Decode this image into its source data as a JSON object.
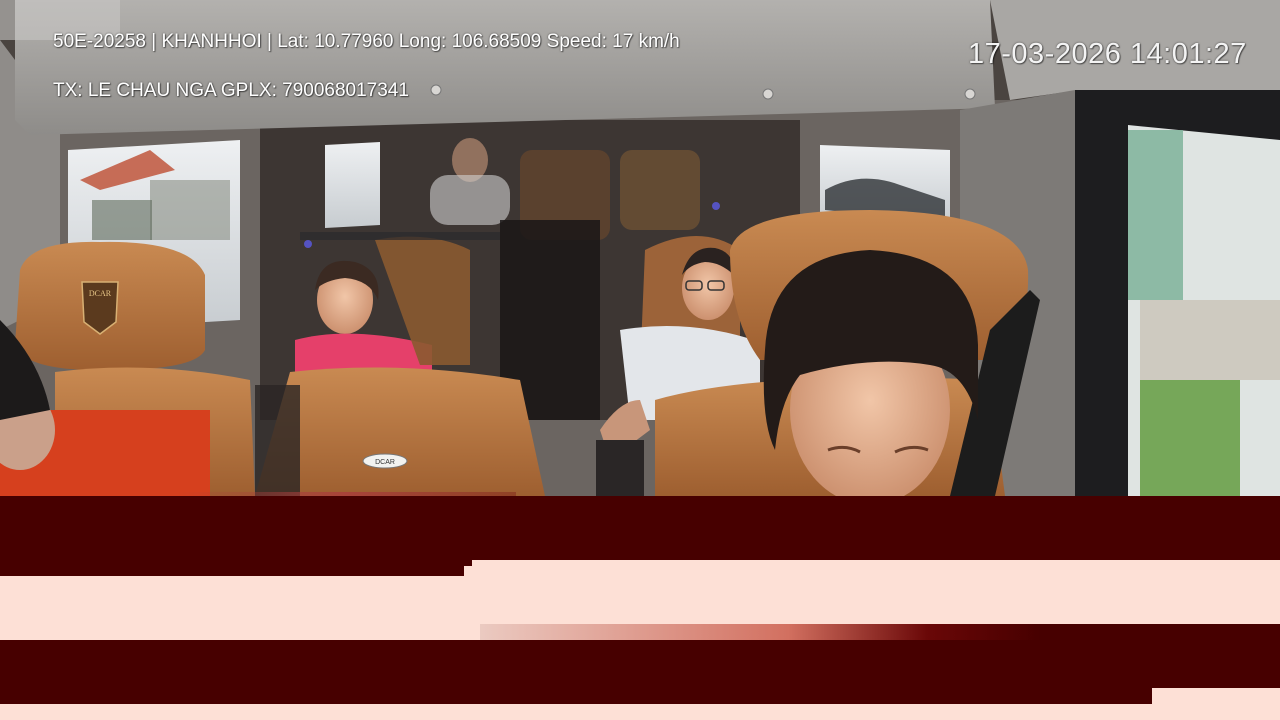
{
  "overlay": {
    "line1": "50E-20258 | KHANHHOI | Lat: 10.77960 Long: 106.68509 Speed: 17 km/h",
    "line2": "TX: LE CHAU NGA GPLX: 790068017341",
    "timestamp": "17-03-2026 14:01:27"
  },
  "seat_badge_text": "DCAR",
  "headrest_logo_text": "DCAR",
  "colors": {
    "corruption_dark": "#470000",
    "corruption_light": "#fde0d6",
    "seat_leather": "#b87540",
    "ceiling": "#9a9896"
  }
}
